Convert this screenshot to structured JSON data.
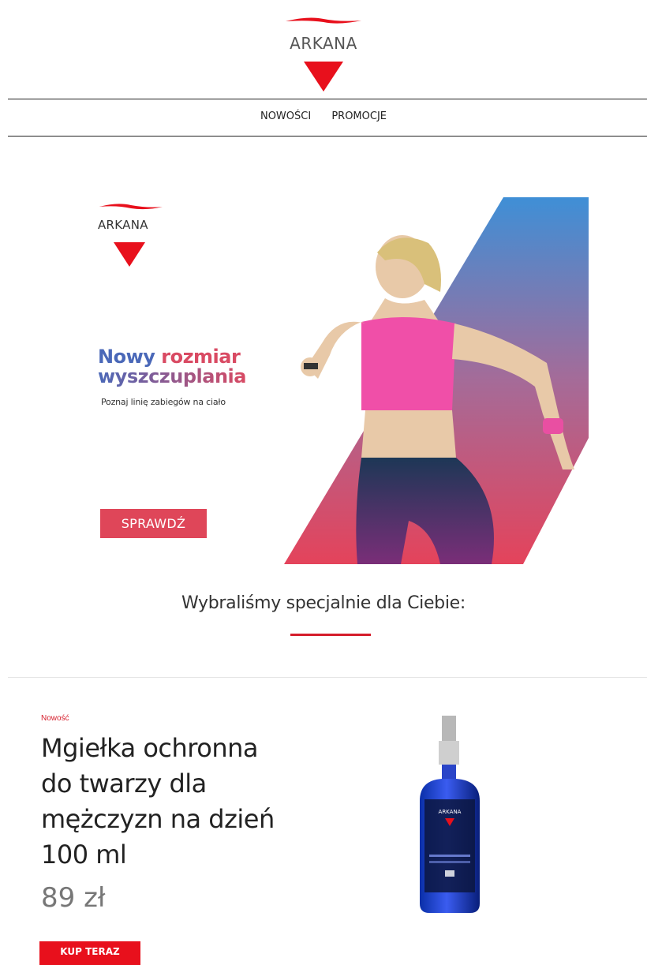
{
  "header": {
    "brand": "ARKANA",
    "nav": [
      "NOWOŚCI",
      "PROMOCJE"
    ]
  },
  "banner": {
    "brand": "ARKANA",
    "headline_part1": "Nowy",
    "headline_part2": "rozmiar",
    "headline_line2": "wyszczuplania",
    "subheadline": "Poznaj linię zabiegów na ciało",
    "cta": "SPRAWDŹ"
  },
  "section": {
    "title": "Wybraliśmy specjalnie dla Ciebie:"
  },
  "product": {
    "badge": "Nowość",
    "name": "Mgiełka ochronna do twarzy dla mężczyzn na dzień 100 ml",
    "price": "89 zł",
    "button": "KUP TERAZ",
    "label_brand": "ARKANA"
  },
  "colors": {
    "brand_red": "#e8101c",
    "banner_pink": "#df4659",
    "banner_blue": "#4a68b8"
  }
}
